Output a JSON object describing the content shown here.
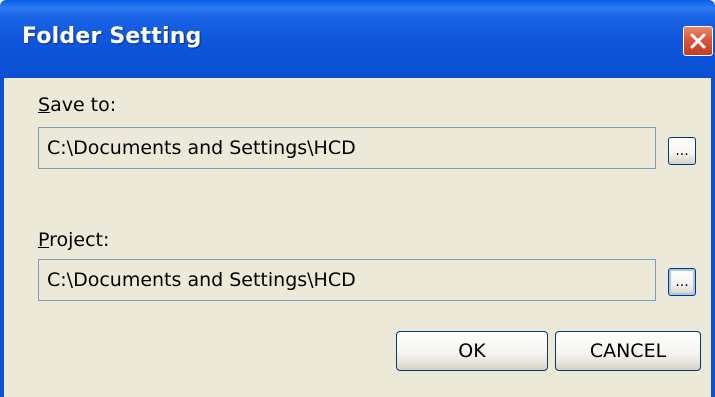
{
  "window": {
    "title": "Folder Setting",
    "close_icon": "close-icon"
  },
  "save_to": {
    "label_mnemonic": "S",
    "label_rest": "ave to:",
    "value": "C:\\Documents and Settings\\HCD",
    "browse_label": "..."
  },
  "project": {
    "label_mnemonic": "P",
    "label_rest": "roject:",
    "value": "C:\\Documents and Settings\\HCD",
    "browse_label": "..."
  },
  "buttons": {
    "ok": "OK",
    "cancel": "CANCEL"
  },
  "colors": {
    "titlebar": "#0c52d7",
    "dialog_face": "#ece9d8",
    "close_button": "#d8563a",
    "field_border": "#7f9db9",
    "button_border": "#003c74"
  }
}
